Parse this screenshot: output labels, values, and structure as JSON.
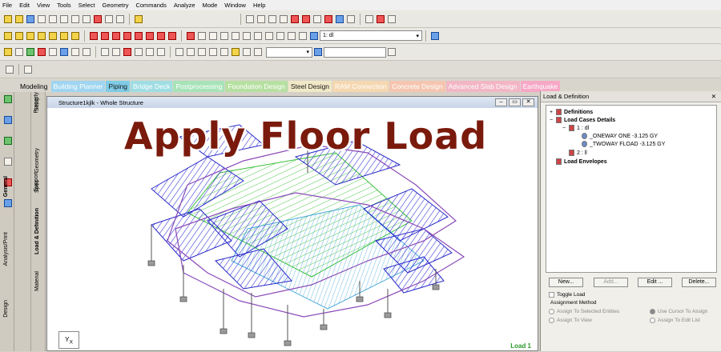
{
  "menu": [
    "File",
    "Edit",
    "View",
    "Tools",
    "Select",
    "Geometry",
    "Commands",
    "Analyze",
    "Mode",
    "Window",
    "Help"
  ],
  "toolbar": {
    "load_combo_value": "1: dl"
  },
  "mode_tabs": {
    "label": "Modeling",
    "items": [
      {
        "label": "Building Planner",
        "bg": "#9fd5f0",
        "fg": "#ffffff"
      },
      {
        "label": "Piping",
        "bg": "#7fcbe6",
        "fg": "#1a1a1a"
      },
      {
        "label": "Bridge Deck",
        "bg": "#9fdde3",
        "fg": "#ffffff"
      },
      {
        "label": "Postprocessing",
        "bg": "#a7e3b8",
        "fg": "#ffffff"
      },
      {
        "label": "Foundation Design",
        "bg": "#b6e0a1",
        "fg": "#ffffff"
      },
      {
        "label": "Steel Design",
        "bg": "#f1e8c6",
        "fg": "#1a1a1a"
      },
      {
        "label": "RAM Connection",
        "bg": "#f5d7b0",
        "fg": "#ffffff"
      },
      {
        "label": "Concrete Design",
        "bg": "#f5c5b0",
        "fg": "#ffffff"
      },
      {
        "label": "Advanced Slab Design",
        "bg": "#f2b6c4",
        "fg": "#ffffff"
      },
      {
        "label": "Earthquake",
        "bg": "#f6a8c6",
        "fg": "#ffffff"
      }
    ]
  },
  "sidebar": {
    "outer": [
      "Design",
      "Analysis/Print",
      "General"
    ],
    "inner": [
      "Material",
      "Load & Definition",
      "Support",
      "Spec",
      "Geometry",
      "Property",
      "Setup"
    ]
  },
  "viewport": {
    "title": "Structure1kjlk - Whole Structure",
    "footer": "Load 1"
  },
  "headline": "Apply Floor Load",
  "panel": {
    "title": "Load & Definition",
    "tree": {
      "definitions": "Definitions",
      "load_cases": "Load Cases Details",
      "case1": "1 : dl",
      "oneway": "_ONEWAY ONE -3.125 GY",
      "twoway": "_TWOWAY FLOAD -3.125 GY",
      "case2": "2 : ll",
      "envelopes": "Load Envelopes"
    },
    "buttons": {
      "new": "New...",
      "add": "Add...",
      "edit": "Edit ...",
      "delete": "Delete..."
    },
    "toggle_load": "Toggle Load",
    "assignment_method": "Assignment Method",
    "options": {
      "selected": "Assign To Selected Entities",
      "cursor": "Use Cursor To Assign",
      "view": "Assign To View",
      "edit_list": "Assign To Edit List"
    }
  },
  "colors": {
    "headline": "#7a1a0c",
    "mesh_blue": "#3a3ad8",
    "mesh_green": "#38c038",
    "frame_purple": "#8a4ab8"
  }
}
